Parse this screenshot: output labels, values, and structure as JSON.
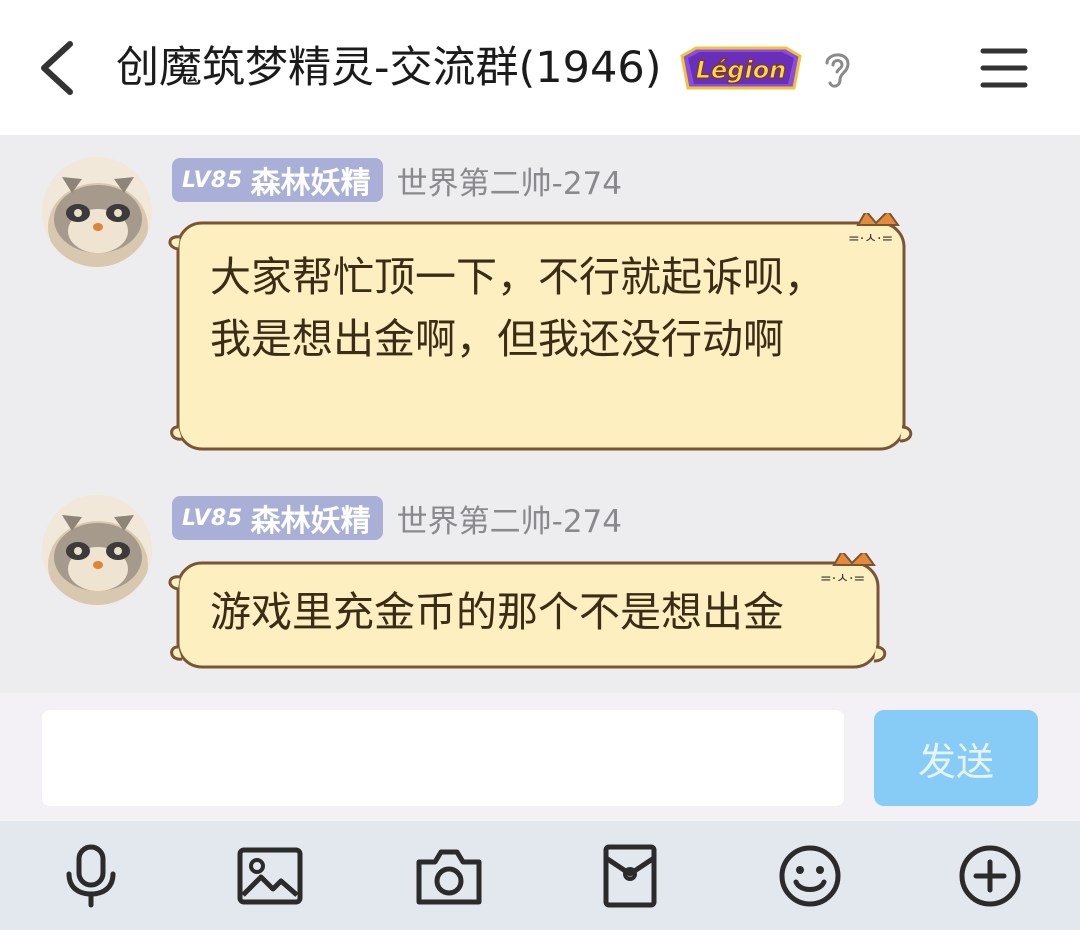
{
  "header": {
    "back_icon": "chevron-left-icon",
    "title": "创魔筑梦精灵-交流群(1946)",
    "badge_text": "Légion",
    "ear_icon": "ear-icon",
    "menu_icon": "hamburger-menu-icon"
  },
  "messages": [
    {
      "level": "LV85",
      "title_name": "森林妖精",
      "nickname": "世界第二帅-274",
      "text": "大家帮忙顶一下，不行就起诉呗，我是想出金啊，但我还没行动啊"
    },
    {
      "level": "LV85",
      "title_name": "森林妖精",
      "nickname": "世界第二帅-274",
      "text": "游戏里充金币的那个不是想出金"
    }
  ],
  "input": {
    "value": "",
    "placeholder": "",
    "send_label": "发送"
  },
  "toolbar": {
    "items": [
      "microphone-icon",
      "image-icon",
      "camera-icon",
      "red-packet-icon",
      "emoji-icon",
      "plus-icon"
    ]
  },
  "colors": {
    "bubble_fill": "#fdefbf",
    "bubble_border": "#7a5533",
    "badge": "#a9afd6",
    "send_button": "#86ccf6",
    "chat_bg": "#ededf0"
  }
}
